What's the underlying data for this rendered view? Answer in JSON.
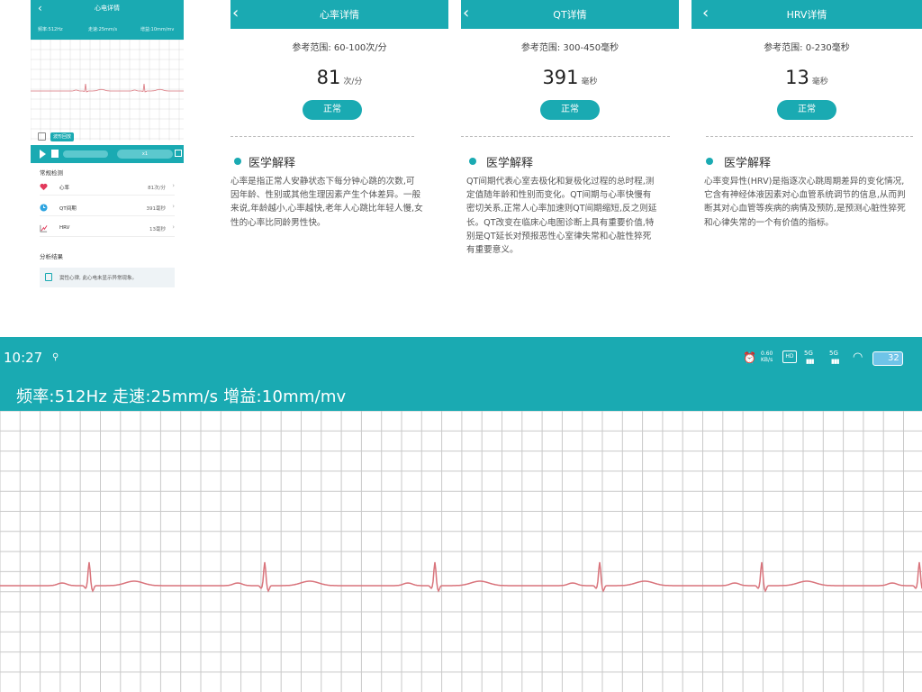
{
  "small_phone": {
    "title": "心电详情",
    "info": {
      "freq": "频率:512Hz",
      "speed": "走速:25mm/s",
      "gain": "增益:10mm/mv"
    },
    "toolbar_btn": "波形回放",
    "speed_label": "x1",
    "section_routine": "常规检测",
    "rows": [
      {
        "name": "心率",
        "value": "81次/分",
        "icon": "heart-icon"
      },
      {
        "name": "QT间期",
        "value": "391毫秒",
        "icon": "clock-icon"
      },
      {
        "name": "HRV",
        "value": "13毫秒",
        "icon": "trend-icon"
      }
    ],
    "section_result": "分析结果",
    "result_text": "窦性心律, 此心电未显示异常现象。"
  },
  "panels": [
    {
      "title": "心率详情",
      "reference": "参考范围: 60-100次/分",
      "value": "81",
      "unit": "次/分",
      "status": "正常",
      "section": "医学解释",
      "explanation": "心率是指正常人安静状态下每分钟心跳的次数,可因年龄、性别或其他生理因素产生个体差异。一般来说,年龄越小,心率越快,老年人心跳比年轻人慢,女性的心率比同龄男性快。"
    },
    {
      "title": "QT详情",
      "reference": "参考范围: 300-450毫秒",
      "value": "391",
      "unit": "毫秒",
      "status": "正常",
      "section": "医学解释",
      "explanation": "QT间期代表心室去极化和复极化过程的总时程,测定值随年龄和性别而变化。QT间期与心率快慢有密切关系,正常人心率加速则QT间期缩短,反之则延长。QT改变在临床心电图诊断上具有重要价值,特别是QT延长对预报恶性心室律失常和心脏性猝死有重要意义。"
    },
    {
      "title": "HRV详情",
      "reference": "参考范围: 0-230毫秒",
      "value": "13",
      "unit": "毫秒",
      "status": "正常",
      "section": "医学解释",
      "explanation": "心率变异性(HRV)是指逐次心跳周期差异的变化情况,它含有神经体液因素对心血管系统调节的信息,从而判断其对心血管等疾病的病情及预防,是预测心脏性猝死和心律失常的一个有价值的指标。"
    }
  ],
  "big_phone": {
    "time": "10:27",
    "network_speed": "0.60 KB/s",
    "signal_1": "5G",
    "signal_2": "5G",
    "battery": "32",
    "info": "频率:512Hz  走速:25mm/s  增益:10mm/mv"
  },
  "colors": {
    "accent": "#1aaab2",
    "ecg_line": "#d9747c",
    "grid": "#c9c9c9"
  }
}
